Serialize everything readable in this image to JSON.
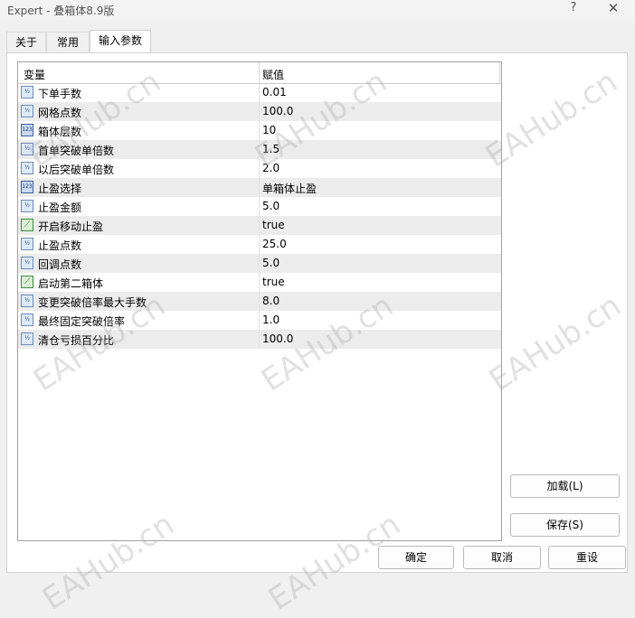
{
  "window": {
    "title": "Expert - 叠箱体8.9版",
    "help_glyph": "?",
    "close_glyph": "✕"
  },
  "tabs": [
    {
      "label": "关于",
      "active": false
    },
    {
      "label": "常用",
      "active": false
    },
    {
      "label": "输入参数",
      "active": true
    }
  ],
  "grid": {
    "headers": {
      "variable": "变量",
      "value": "赋值"
    },
    "rows": [
      {
        "icon": "double-type-icon",
        "icon_text": "½",
        "name": "下单手数",
        "value": "0.01"
      },
      {
        "icon": "double-type-icon",
        "icon_text": "½",
        "name": "网格点数",
        "value": "100.0"
      },
      {
        "icon": "integer-type-icon",
        "icon_text": "123",
        "name": "箱体层数",
        "value": "10"
      },
      {
        "icon": "double-type-icon",
        "icon_text": "½",
        "name": "首单突破单倍数",
        "value": "1.5"
      },
      {
        "icon": "double-type-icon",
        "icon_text": "½",
        "name": "以后突破单倍数",
        "value": "2.0"
      },
      {
        "icon": "integer-type-icon",
        "icon_text": "123",
        "name": "止盈选择",
        "value": "单箱体止盈"
      },
      {
        "icon": "double-type-icon",
        "icon_text": "½",
        "name": "止盈金额",
        "value": "5.0"
      },
      {
        "icon": "bool-type-icon",
        "icon_text": "⟋",
        "name": "开启移动止盈",
        "value": "true"
      },
      {
        "icon": "double-type-icon",
        "icon_text": "½",
        "name": "止盈点数",
        "value": "25.0"
      },
      {
        "icon": "double-type-icon",
        "icon_text": "½",
        "name": "回调点数",
        "value": "5.0"
      },
      {
        "icon": "bool-type-icon",
        "icon_text": "⟋",
        "name": "启动第二箱体",
        "value": "true"
      },
      {
        "icon": "double-type-icon",
        "icon_text": "½",
        "name": "变更突破倍率最大手数",
        "value": "8.0"
      },
      {
        "icon": "double-type-icon",
        "icon_text": "½",
        "name": "最终固定突破倍率",
        "value": "1.0"
      },
      {
        "icon": "double-type-icon",
        "icon_text": "½",
        "name": "清仓亏损百分比",
        "value": "100.0"
      }
    ]
  },
  "buttons": {
    "load": "加载(L)",
    "save": "保存(S)",
    "ok": "确定",
    "cancel": "取消",
    "reset": "重设"
  },
  "watermark": "EAHub.cn"
}
